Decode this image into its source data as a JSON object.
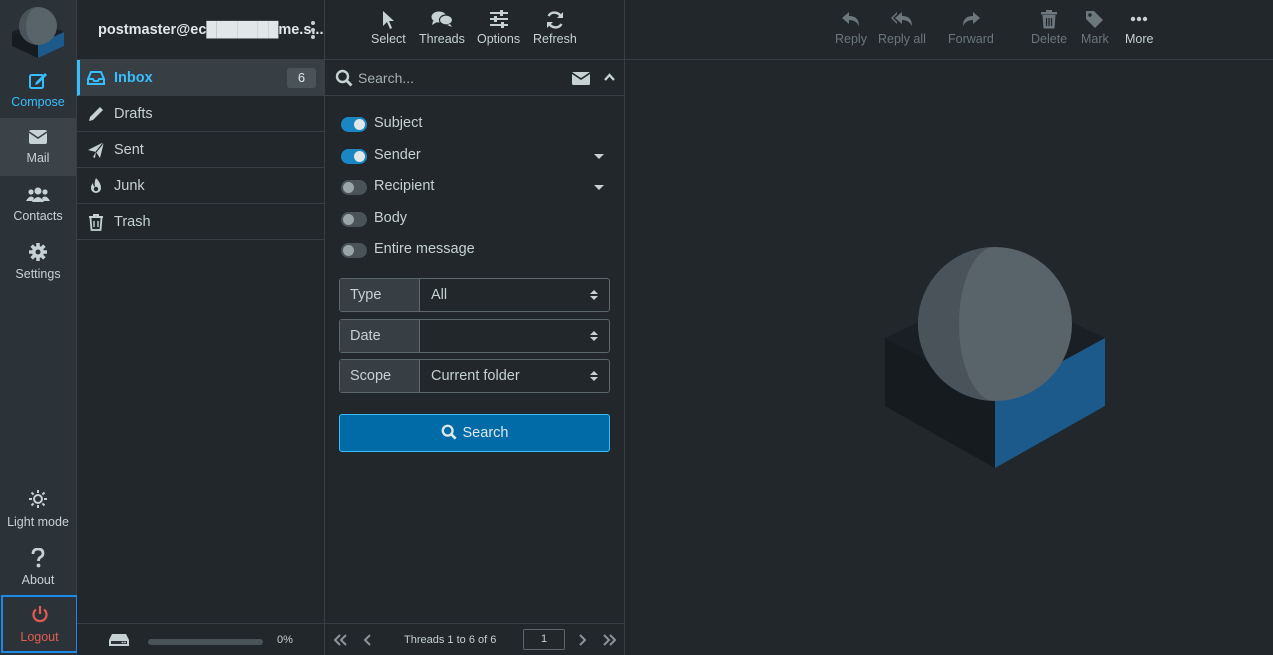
{
  "rail": {
    "compose": "Compose",
    "mail": "Mail",
    "contacts": "Contacts",
    "settings": "Settings",
    "light_mode": "Light mode",
    "about": "About",
    "logout": "Logout"
  },
  "account": {
    "name": "postmaster@ec███████me.s..."
  },
  "folders": [
    {
      "label": "Inbox",
      "count": "6",
      "icon": "inbox-icon"
    },
    {
      "label": "Drafts",
      "icon": "pencil-icon"
    },
    {
      "label": "Sent",
      "icon": "paper-plane-icon"
    },
    {
      "label": "Junk",
      "icon": "fire-icon"
    },
    {
      "label": "Trash",
      "icon": "trash-icon"
    }
  ],
  "quota": {
    "percent_text": "0%",
    "fraction": 0
  },
  "list_toolbar": {
    "select": "Select",
    "threads": "Threads",
    "options": "Options",
    "refresh": "Refresh"
  },
  "search": {
    "placeholder": "Search...",
    "options": [
      {
        "label": "Subject",
        "on": true
      },
      {
        "label": "Sender",
        "on": true
      },
      {
        "label": "Recipient",
        "on": false
      },
      {
        "label": "Body",
        "on": false
      },
      {
        "label": "Entire message",
        "on": false
      }
    ],
    "type": {
      "label": "Type",
      "value": "All"
    },
    "date": {
      "label": "Date",
      "value": ""
    },
    "scope": {
      "label": "Scope",
      "value": "Current folder"
    },
    "button": "Search"
  },
  "pager": {
    "count_text": "Threads 1 to 6 of 6",
    "page": "1"
  },
  "message_toolbar": {
    "reply": "Reply",
    "reply_all": "Reply all",
    "forward": "Forward",
    "delete": "Delete",
    "mark": "Mark",
    "more": "More"
  },
  "colors": {
    "accent": "#37beff",
    "primary_button": "#006ba6",
    "logout": "#e45b53",
    "background": "#21272b"
  }
}
